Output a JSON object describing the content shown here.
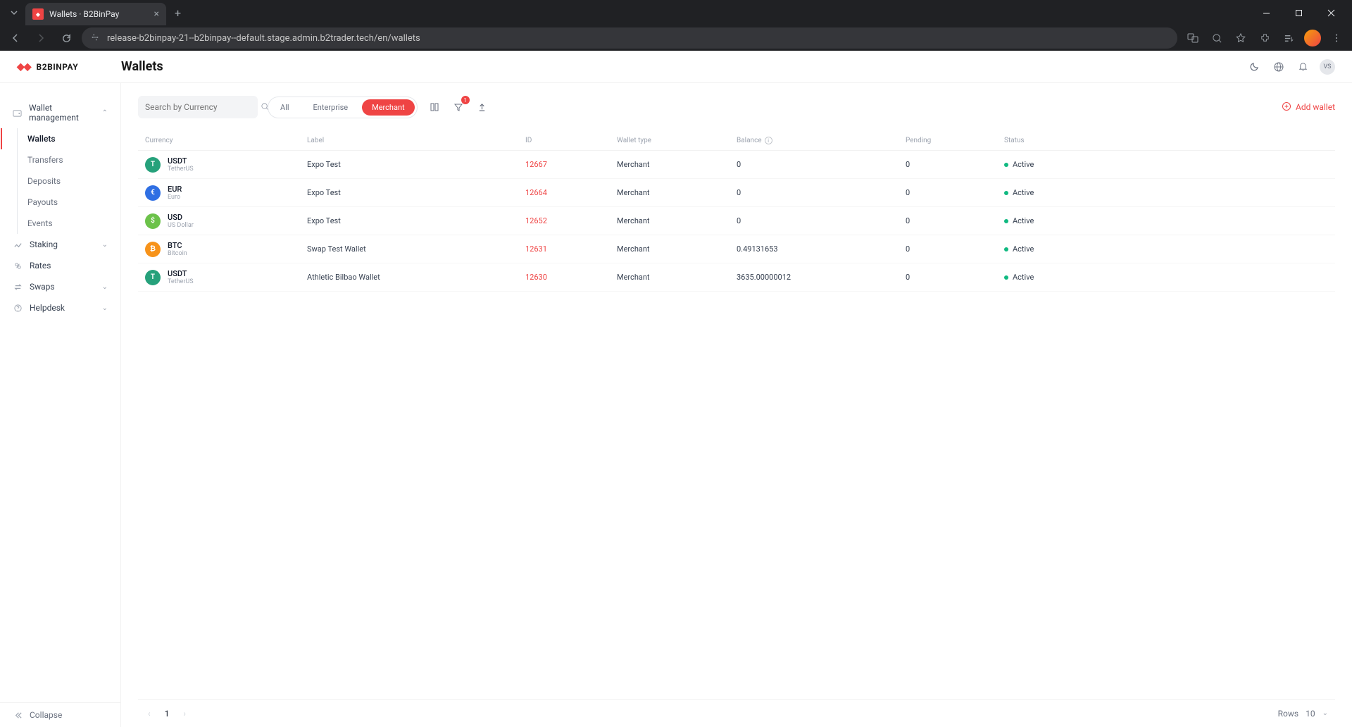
{
  "browser": {
    "tab_title": "Wallets · B2BinPay",
    "url": "release-b2binpay-21--b2binpay--default.stage.admin.b2trader.tech/en/wallets"
  },
  "header": {
    "logo_text": "B2BINPAY",
    "page_title": "Wallets",
    "avatar_initials": "VS"
  },
  "sidebar": {
    "wallet_mgmt": "Wallet management",
    "items": [
      "Wallets",
      "Transfers",
      "Deposits",
      "Payouts",
      "Events"
    ],
    "staking": "Staking",
    "rates": "Rates",
    "swaps": "Swaps",
    "helpdesk": "Helpdesk",
    "collapse": "Collapse"
  },
  "toolbar": {
    "search_placeholder": "Search by Currency",
    "chips": [
      "All",
      "Enterprise",
      "Merchant"
    ],
    "filter_badge": "1",
    "add_wallet": "Add wallet"
  },
  "table": {
    "headers": {
      "currency": "Currency",
      "label": "Label",
      "id": "ID",
      "type": "Wallet type",
      "balance": "Balance",
      "pending": "Pending",
      "status": "Status"
    },
    "rows": [
      {
        "sym": "USDT",
        "name": "TetherUS",
        "color": "#26a17b",
        "glyph": "T",
        "label": "Expo Test",
        "id": "12667",
        "type": "Merchant",
        "balance": "0",
        "pending": "0",
        "status": "Active"
      },
      {
        "sym": "EUR",
        "name": "Euro",
        "color": "#2f6fe3",
        "glyph": "€",
        "label": "Expo Test",
        "id": "12664",
        "type": "Merchant",
        "balance": "0",
        "pending": "0",
        "status": "Active"
      },
      {
        "sym": "USD",
        "name": "US Dollar",
        "color": "#6cc24a",
        "glyph": "$",
        "label": "Expo Test",
        "id": "12652",
        "type": "Merchant",
        "balance": "0",
        "pending": "0",
        "status": "Active"
      },
      {
        "sym": "BTC",
        "name": "Bitcoin",
        "color": "#f7931a",
        "glyph": "₿",
        "label": "Swap Test Wallet",
        "id": "12631",
        "type": "Merchant",
        "balance": "0.49131653",
        "pending": "0",
        "status": "Active"
      },
      {
        "sym": "USDT",
        "name": "TetherUS",
        "color": "#26a17b",
        "glyph": "T",
        "label": "Athletic Bilbao Wallet",
        "id": "12630",
        "type": "Merchant",
        "balance": "3635.00000012",
        "pending": "0",
        "status": "Active"
      }
    ]
  },
  "footer": {
    "page": "1",
    "rows_label": "Rows",
    "rows_value": "10"
  }
}
